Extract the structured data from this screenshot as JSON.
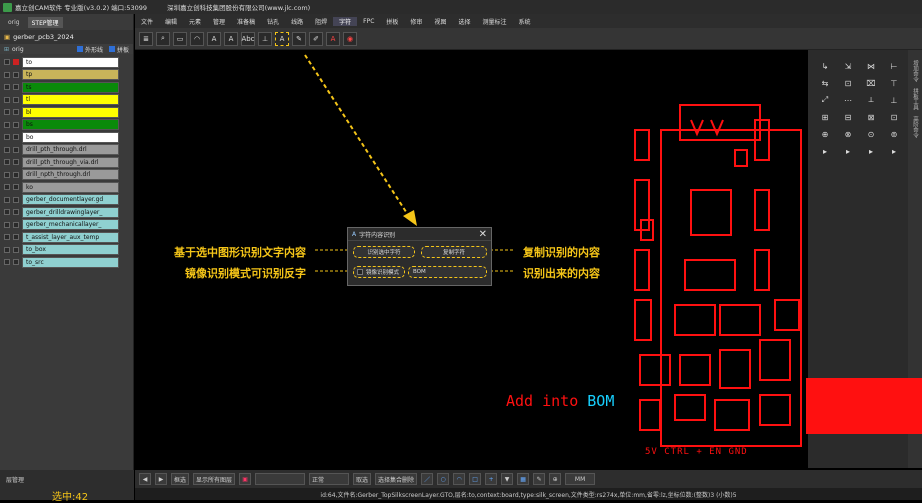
{
  "titlebar": {
    "app": "嘉立创CAM软件 专业版(v3.0.2) 端口:53099",
    "company": "深圳嘉立创科技集团股份有限公司(www.jlc.com)"
  },
  "left": {
    "tabs": [
      "orig",
      "STEP管理"
    ],
    "project": "gerber_pcb3_2024",
    "step": "orig",
    "outline_label": "外形线",
    "panel_label": "拼板",
    "layers": [
      {
        "name": "to",
        "color": "#ffffff"
      },
      {
        "name": "tp",
        "color": "#c8b45a"
      },
      {
        "name": "ts",
        "color": "#0a8a0a"
      },
      {
        "name": "tl",
        "color": "#ffff00"
      },
      {
        "name": "bl",
        "color": "#ffff00"
      },
      {
        "name": "bs",
        "color": "#0a8a0a"
      },
      {
        "name": "bo",
        "color": "#ffffff"
      },
      {
        "name": "drill_pth_through.drl",
        "color": "#9a9a9a"
      },
      {
        "name": "drill_pth_through_via.drl",
        "color": "#9a9a9a"
      },
      {
        "name": "drill_npth_through.drl",
        "color": "#9a9a9a"
      },
      {
        "name": "ko",
        "color": "#9a9a9a"
      },
      {
        "name": "gerber_documentlayer.gd",
        "color": "#8fd0d0"
      },
      {
        "name": "gerber_drilldrawinglayer_",
        "color": "#8fd0d0"
      },
      {
        "name": "gerber_mechanicallayer_",
        "color": "#8fd0d0"
      },
      {
        "name": "t_assist_layer_aux_temp",
        "color": "#8fd0d0"
      },
      {
        "name": "to_box",
        "color": "#8fd0d0"
      },
      {
        "name": "to_src",
        "color": "#8fd0d0"
      }
    ],
    "manager": "层管理",
    "selected": "选中:42"
  },
  "menus": [
    "文件",
    "编辑",
    "元素",
    "管理",
    "准备稿",
    "钻孔",
    "线路",
    "阻焊",
    "字符",
    "FPC",
    "拼板",
    "修审",
    "视图",
    "选择",
    "测量标注",
    "系统"
  ],
  "active_menu": "字符",
  "toolbar_icons": [
    "layers-icon",
    "zoom-icon",
    "fit-icon",
    "arc-icon",
    "text-a-icon",
    "text-a2-icon",
    "abc-icon",
    "measure-icon",
    "text-recognize-icon",
    "pen-icon",
    "edit-icon",
    "font-icon",
    "target-icon"
  ],
  "dialog": {
    "title": "字符内容识别",
    "recognize_btn": "识别选中字符",
    "copy_btn": "复制字符",
    "mirror_label": "镜像识别模式",
    "result": "BOM"
  },
  "annotations": {
    "left1": "基于选中图形识别文字内容",
    "left2": "镜像识别模式可识别反字",
    "right1": "复制识别的内容",
    "right2": "识别出来的内容"
  },
  "pcb": {
    "text1": "Add into",
    "text1b": "BOM",
    "text2": "5V CTRL  +    EN GND"
  },
  "right_tabs": [
    "增加命令",
    "拼板工具",
    "高阶命令"
  ],
  "bottom": {
    "mode": "框选",
    "show_all": "显示所有图层",
    "normal": "正常",
    "select_btn": "取选",
    "delete_btn": "选择集合删除",
    "unit": "MM"
  },
  "status": "id:64,文件名:Gerber_TopSilkscreenLayer.GTO,层名:to,context:board,type:silk_screen,文件类型:rs274x,单位:mm,省零:lz,坐标位数:(整数)3 (小数)5"
}
